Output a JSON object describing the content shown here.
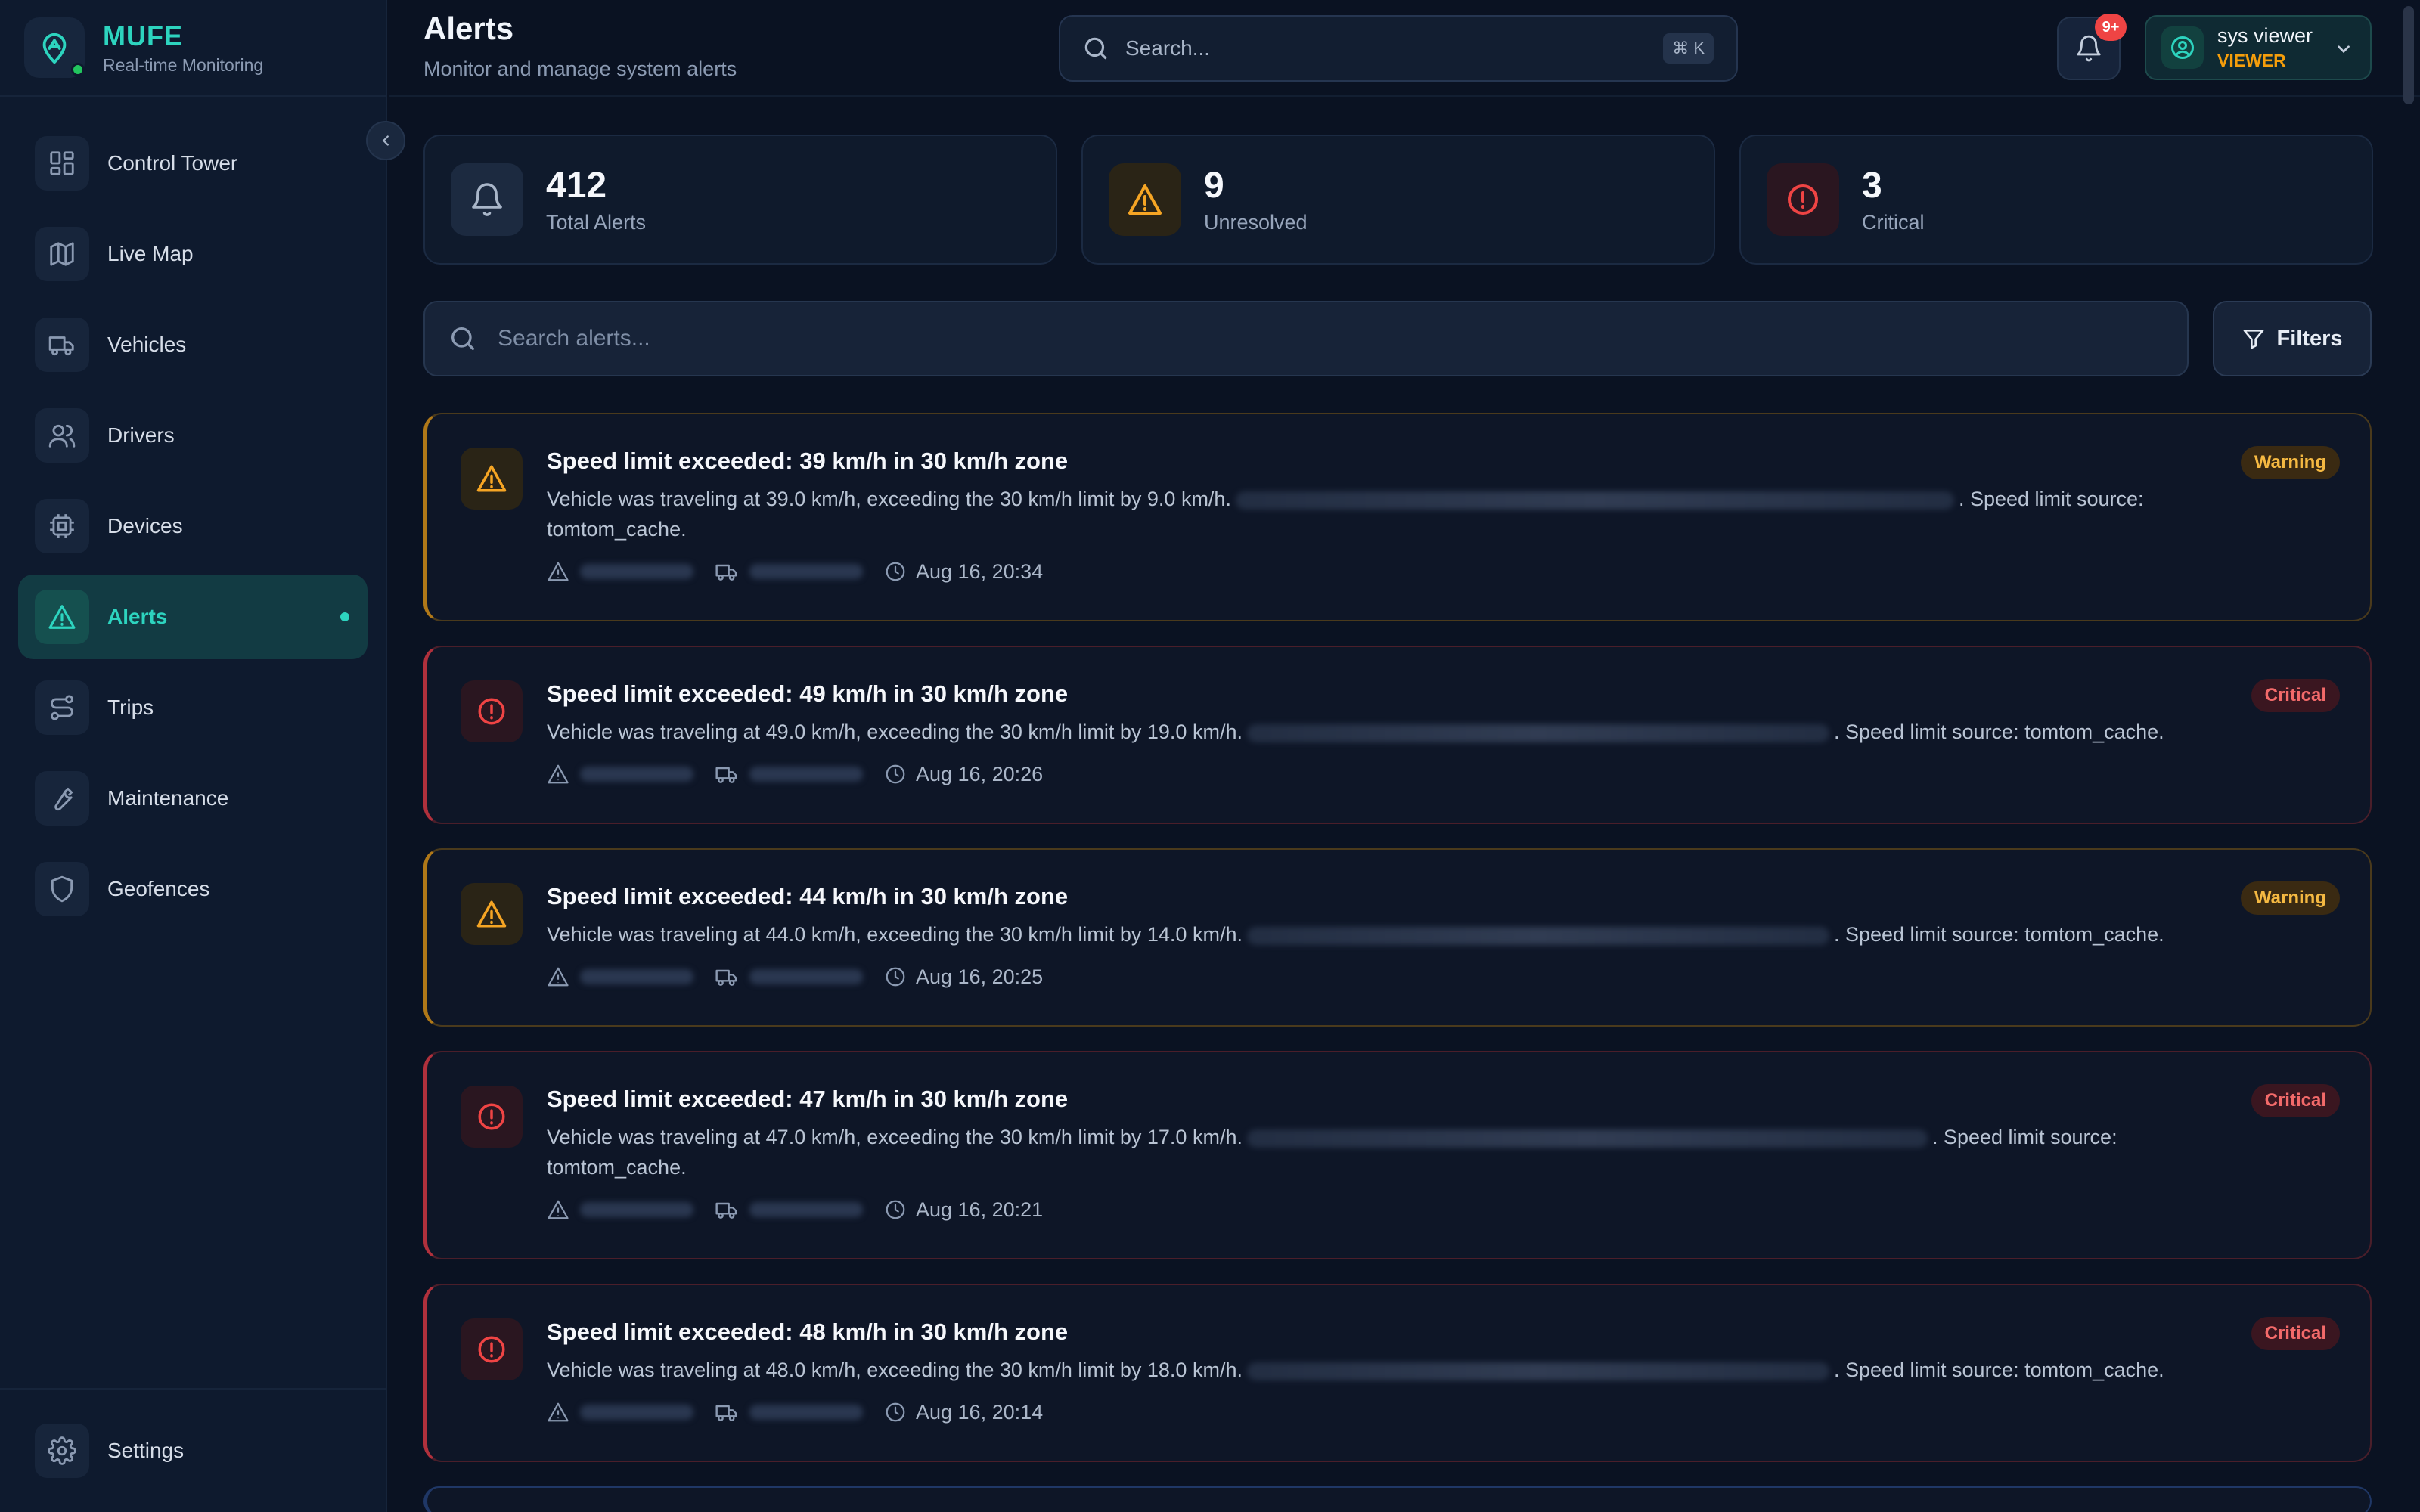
{
  "brand": {
    "name": "MUFE",
    "subtitle": "Real-time Monitoring"
  },
  "sidebar": {
    "items": [
      {
        "label": "Control Tower",
        "icon": "grid-icon",
        "active": false
      },
      {
        "label": "Live Map",
        "icon": "map-icon",
        "active": false
      },
      {
        "label": "Vehicles",
        "icon": "truck-icon",
        "active": false
      },
      {
        "label": "Drivers",
        "icon": "users-icon",
        "active": false
      },
      {
        "label": "Devices",
        "icon": "chip-icon",
        "active": false
      },
      {
        "label": "Alerts",
        "icon": "warning-icon",
        "active": true
      },
      {
        "label": "Trips",
        "icon": "route-icon",
        "active": false
      },
      {
        "label": "Maintenance",
        "icon": "wrench-icon",
        "active": false
      },
      {
        "label": "Geofences",
        "icon": "shield-icon",
        "active": false
      }
    ],
    "footer": {
      "label": "Settings",
      "icon": "gear-icon"
    }
  },
  "header": {
    "title": "Alerts",
    "subtitle": "Monitor and manage system alerts",
    "search_placeholder": "Search...",
    "shortcut": "⌘ K",
    "notification_badge": "9+",
    "user": {
      "name": "sys viewer",
      "role": "VIEWER"
    }
  },
  "stats": [
    {
      "value": "412",
      "label": "Total Alerts",
      "icon": "bell-icon"
    },
    {
      "value": "9",
      "label": "Unresolved",
      "icon": "warning-icon"
    },
    {
      "value": "3",
      "label": "Critical",
      "icon": "alert-circle-icon"
    }
  ],
  "alert_search": {
    "placeholder": "Search alerts...",
    "filters_label": "Filters"
  },
  "colors": {
    "accent": "#2dd4bf",
    "warning": "#f5b942",
    "critical": "#f36a6a",
    "background": "#0a1222"
  },
  "alerts": [
    {
      "severity": "Warning",
      "title": "Speed limit exceeded: 39 km/h in 30 km/h zone",
      "desc_a": "Vehicle was traveling at 39.0 km/h, exceeding the 30 km/h limit by 9.0 km/h.",
      "desc_b": ". Speed limit source: tomtom_cache.",
      "time": "Aug 16, 20:34"
    },
    {
      "severity": "Critical",
      "title": "Speed limit exceeded: 49 km/h in 30 km/h zone",
      "desc_a": "Vehicle was traveling at 49.0 km/h, exceeding the 30 km/h limit by 19.0 km/h.",
      "desc_b": ". Speed limit source: tomtom_cache.",
      "time": "Aug 16, 20:26"
    },
    {
      "severity": "Warning",
      "title": "Speed limit exceeded: 44 km/h in 30 km/h zone",
      "desc_a": "Vehicle was traveling at 44.0 km/h, exceeding the 30 km/h limit by 14.0 km/h.",
      "desc_b": ". Speed limit source: tomtom_cache.",
      "time": "Aug 16, 20:25"
    },
    {
      "severity": "Critical",
      "title": "Speed limit exceeded: 47 km/h in 30 km/h zone",
      "desc_a": "Vehicle was traveling at 47.0 km/h, exceeding the 30 km/h limit by 17.0 km/h.",
      "desc_b": ". Speed limit source: tomtom_cache.",
      "time": "Aug 16, 20:21"
    },
    {
      "severity": "Critical",
      "title": "Speed limit exceeded: 48 km/h in 30 km/h zone",
      "desc_a": "Vehicle was traveling at 48.0 km/h, exceeding the 30 km/h limit by 18.0 km/h.",
      "desc_b": ". Speed limit source: tomtom_cache.",
      "time": "Aug 16, 20:14"
    }
  ]
}
